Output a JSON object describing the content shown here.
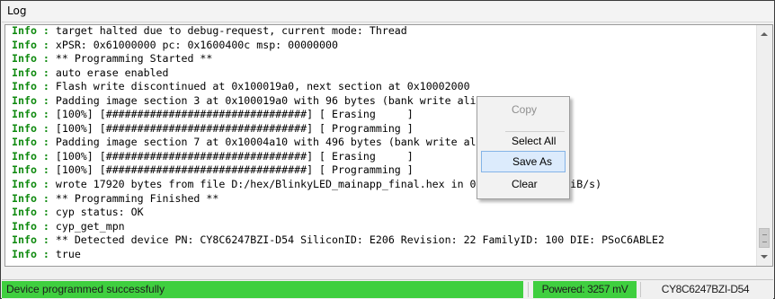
{
  "window": {
    "title": "Log"
  },
  "log": {
    "lines": [
      {
        "tag": "Info",
        "sep": " : ",
        "msg": "target halted due to debug-request, current mode: Thread"
      },
      {
        "tag": "Info",
        "sep": " : ",
        "msg": "xPSR: 0x61000000 pc: 0x1600400c msp: 00000000"
      },
      {
        "tag": "Info",
        "sep": " : ",
        "msg": "** Programming Started **"
      },
      {
        "tag": "Info",
        "sep": " : ",
        "msg": "auto erase enabled"
      },
      {
        "tag": "Info",
        "sep": " : ",
        "msg": "Flash write discontinued at 0x100019a0, next section at 0x10002000"
      },
      {
        "tag": "Info",
        "sep": " : ",
        "msg": "Padding image section 3 at 0x100019a0 with 96 bytes (bank write alignment)"
      },
      {
        "tag": "Info",
        "sep": " : ",
        "msg": "[100%] [################################] [ Erasing     ]"
      },
      {
        "tag": "Info",
        "sep": " : ",
        "msg": "[100%] [################################] [ Programming ]"
      },
      {
        "tag": "Info",
        "sep": " : ",
        "msg": "Padding image section 7 at 0x10004a10 with 496 bytes (bank write alignment)"
      },
      {
        "tag": "Info",
        "sep": " : ",
        "msg": "[100%] [################################] [ Erasing     ]"
      },
      {
        "tag": "Info",
        "sep": " : ",
        "msg": "[100%] [################################] [ Programming ]"
      },
      {
        "tag": "Info",
        "sep": " : ",
        "msg": "wrote 17920 bytes from file D:/hex/BlinkyLED_mainapp_final.hex in 0.874s (20.034 KiB/s)"
      },
      {
        "tag": "Info",
        "sep": " : ",
        "msg": "** Programming Finished **"
      },
      {
        "tag": "Info",
        "sep": " : ",
        "msg": "cyp status: OK"
      },
      {
        "tag": "Info",
        "sep": " : ",
        "msg": "cyp_get_mpn"
      },
      {
        "tag": "Info",
        "sep": " : ",
        "msg": "** Detected device PN: CY8C6247BZI-D54 SiliconID: E206 Revision: 22 FamilyID: 100 DIE: PSoC6ABLE2"
      },
      {
        "tag": "Info",
        "sep": " : ",
        "msg": "true"
      }
    ]
  },
  "context_menu": {
    "items": [
      {
        "label": "Copy",
        "enabled": false,
        "highlighted": false
      },
      {
        "label": "Select All",
        "enabled": true,
        "highlighted": false
      },
      {
        "label": "Save As",
        "enabled": true,
        "highlighted": true
      },
      {
        "label": "Clear",
        "enabled": true,
        "highlighted": false
      }
    ]
  },
  "status_bar": {
    "message": "Device programmed successfully",
    "power": "Powered:  3257 mV",
    "device": "CY8C6247BZI-D54",
    "accent_color": "#3fcf3f"
  },
  "icons": {
    "scroll_up": "chevron-up-icon",
    "scroll_down": "chevron-down-icon",
    "scroll_grip": "grip-lines-icon"
  }
}
